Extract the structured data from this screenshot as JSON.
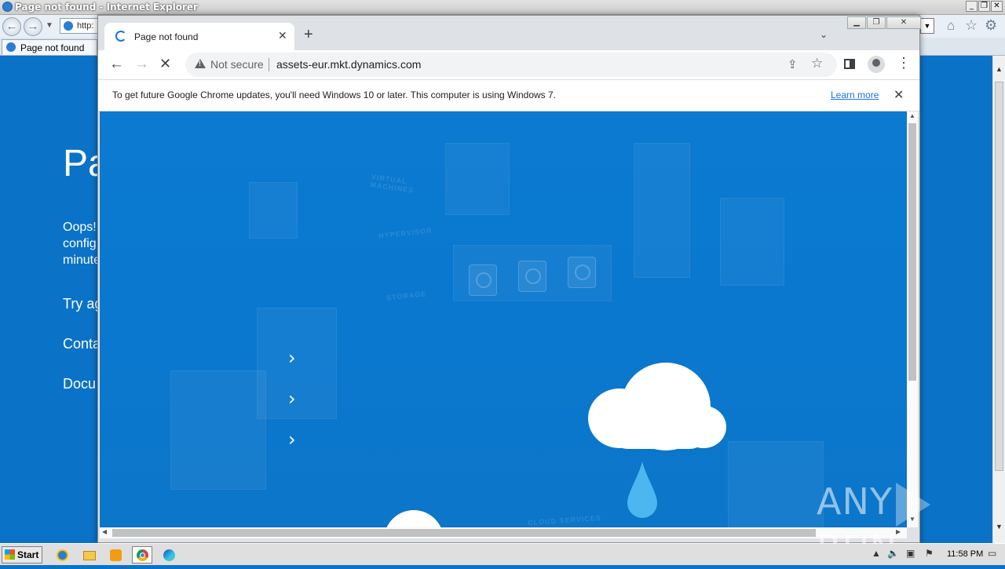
{
  "ie": {
    "window_title": "Page not found - Internet Explorer",
    "address_partial": "http:",
    "tab_label": "Page not found",
    "page": {
      "heading_partial": "Pa",
      "paragraph_partial": "Oops!\nconfig\nminute",
      "link1_partial": "Try ag",
      "link2_partial": "Conta",
      "link3_partial": "Docu"
    }
  },
  "chrome": {
    "tab_title": "Page not found",
    "security_label": "Not secure",
    "url": "assets-eur.mkt.dynamics.com",
    "infobar_message": "To get future Google Chrome updates, you'll need Windows 10 or later. This computer is using Windows 7.",
    "infobar_link": "Learn more",
    "content_labels": {
      "virtual_machines": "VIRTUAL\nMACHINES",
      "hypervisor": "HYPERVISOR",
      "storage": "STORAGE",
      "cloud_services": "CLOUD SERVICES"
    }
  },
  "watermark": {
    "left": "ANY",
    "right": "RUN"
  },
  "taskbar": {
    "start_label": "Start",
    "clock": "11:58 PM"
  },
  "colors": {
    "page_blue": "#0a73c8",
    "chrome_frame": "#dee1e6",
    "link_blue": "#1a73e8"
  },
  "icons": [
    "ie-icon",
    "back-icon",
    "forward-icon",
    "home-icon",
    "favorites-icon",
    "tools-gear-icon",
    "loading-spinner-icon",
    "close-icon",
    "plus-icon",
    "chevron-down-icon",
    "reload-stop-icon",
    "warning-icon",
    "share-icon",
    "star-icon",
    "side-panel-icon",
    "profile-icon",
    "kebab-menu-icon",
    "chevron-right-icon",
    "cloud-icon",
    "water-drop-icon",
    "windows-logo-icon",
    "folder-icon",
    "media-player-icon",
    "chrome-icon",
    "edge-icon"
  ]
}
